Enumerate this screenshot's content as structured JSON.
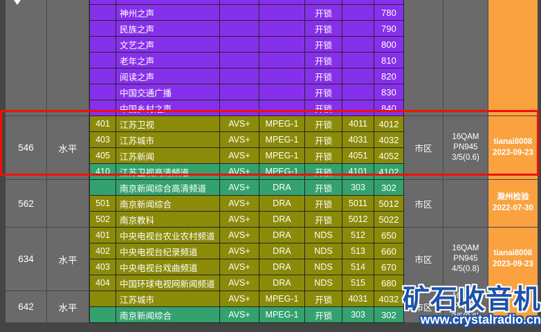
{
  "colors": {
    "purple_row": "#8730EB",
    "olive_row": "#8B8B09",
    "green_row": "#34A26E",
    "orange_source": "#F9A23F",
    "gray_cell": "#6A6A6A",
    "background": "#454545",
    "highlight_red": "#F11006",
    "watermark_blue": "#1C53AC"
  },
  "watermark": {
    "title": "矿石收音机",
    "url": "www.crystalradio.cn"
  },
  "table": {
    "sections": [
      {
        "freq": "",
        "polarization": "",
        "area": "",
        "modulation": "",
        "source": "",
        "rows": [
          {
            "ch": "",
            "name": "神州之声",
            "video": "",
            "audio": "",
            "status": "开锁",
            "pid1": "",
            "pid2": "780"
          },
          {
            "ch": "",
            "name": "民族之声",
            "video": "",
            "audio": "",
            "status": "开锁",
            "pid1": "",
            "pid2": "790"
          },
          {
            "ch": "",
            "name": "文艺之声",
            "video": "",
            "audio": "",
            "status": "开锁",
            "pid1": "",
            "pid2": "800"
          },
          {
            "ch": "",
            "name": "老年之声",
            "video": "",
            "audio": "",
            "status": "开锁",
            "pid1": "",
            "pid2": "810"
          },
          {
            "ch": "",
            "name": "阅读之声",
            "video": "",
            "audio": "",
            "status": "开锁",
            "pid1": "",
            "pid2": "820"
          },
          {
            "ch": "",
            "name": "中国交通广播",
            "video": "",
            "audio": "",
            "status": "开锁",
            "pid1": "",
            "pid2": "830"
          },
          {
            "ch": "",
            "name": "中国乡村之声",
            "video": "",
            "audio": "",
            "status": "开锁",
            "pid1": "",
            "pid2": "840"
          }
        ]
      },
      {
        "freq": "546",
        "polarization": "水平",
        "area": "市区",
        "modulation": "16QAM\nPN945\n3/5(0.6)",
        "source": "tianai8008\n2023-09-23",
        "rows": [
          {
            "ch": "401",
            "name": "江苏卫视",
            "video": "AVS+",
            "audio": "MPEG-1",
            "status": "开锁",
            "pid1": "4011",
            "pid2": "4012"
          },
          {
            "ch": "403",
            "name": "江苏城市",
            "video": "AVS+",
            "audio": "MPEG-1",
            "status": "开锁",
            "pid1": "4031",
            "pid2": "4032"
          },
          {
            "ch": "405",
            "name": "江苏新闻",
            "video": "AVS+",
            "audio": "MPEG-1",
            "status": "开锁",
            "pid1": "4051",
            "pid2": "4052"
          },
          {
            "ch": "410",
            "name": "江苏卫视高清频道",
            "video": "AVS+",
            "audio": "MPEG-1",
            "status": "开锁",
            "pid1": "4101",
            "pid2": "4102"
          }
        ]
      },
      {
        "freq": "562",
        "polarization": "",
        "area": "市区",
        "modulation": "",
        "source": "滁州检验\n2022-07-30",
        "rows": [
          {
            "ch": "",
            "name": "南京新闻综合高清频道",
            "video": "AVS+",
            "audio": "DRA",
            "status": "开锁",
            "pid1": "303",
            "pid2": "302"
          },
          {
            "ch": "501",
            "name": "南京新闻综合",
            "video": "AVS+",
            "audio": "DRA",
            "status": "开锁",
            "pid1": "5011",
            "pid2": "5012"
          },
          {
            "ch": "502",
            "name": "南京教科",
            "video": "AVS+",
            "audio": "DRA",
            "status": "开锁",
            "pid1": "5012",
            "pid2": "5022"
          }
        ]
      },
      {
        "freq": "634",
        "polarization": "水平",
        "area": "市区",
        "modulation": "16QAM\nPN945\n4/5(0.8)",
        "source": "tianai8008\n2023-09-23",
        "rows": [
          {
            "ch": "401",
            "name": "中央电视台农业农村频道",
            "video": "AVS+",
            "audio": "DRA",
            "status": "NDS",
            "pid1": "512",
            "pid2": "650"
          },
          {
            "ch": "402",
            "name": "中央电视台纪录频道",
            "video": "AVS+",
            "audio": "DRA",
            "status": "NDS",
            "pid1": "513",
            "pid2": "660"
          },
          {
            "ch": "403",
            "name": "中央电视台戏曲频道",
            "video": "AVS+",
            "audio": "DRA",
            "status": "NDS",
            "pid1": "514",
            "pid2": "670"
          },
          {
            "ch": "404",
            "name": "中国环球电视网新闻频道",
            "video": "AVS+",
            "audio": "DRA",
            "status": "NDS",
            "pid1": "515",
            "pid2": "680"
          }
        ]
      },
      {
        "freq": "642",
        "polarization": "水平",
        "area": "市区",
        "modulation": "16QAM\nPN945\n3/5(0.6)",
        "source": "",
        "rows": [
          {
            "ch": "",
            "name": "江苏城市",
            "video": "AVS+",
            "audio": "MPEG-1",
            "status": "开锁",
            "pid1": "4031",
            "pid2": "4032"
          },
          {
            "ch": "",
            "name": "南京新闻综合",
            "video": "AVS+",
            "audio": "MPEG-1",
            "status": "开锁",
            "pid1": "303",
            "pid2": "302"
          }
        ]
      }
    ]
  }
}
